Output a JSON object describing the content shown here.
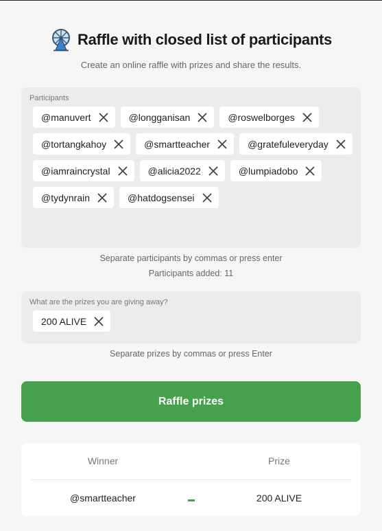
{
  "header": {
    "title": "Raffle with closed list of participants",
    "subtitle": "Create an online raffle with prizes and share the results."
  },
  "participants": {
    "label": "Participants",
    "items": [
      "@manuvert",
      "@longganisan",
      "@roswelborges",
      "@tortangkahoy",
      "@smartteacher",
      "@gratefuleveryday",
      "@iamraincrystal",
      "@alicia2022",
      "@lumpiadobo",
      "@tydynrain",
      "@hatdogsensei"
    ],
    "helper": "Separate participants by commas or press enter",
    "count_text": "Participants added: 11"
  },
  "prizes": {
    "label": "What are the prizes you are giving away?",
    "items": [
      "200 ALIVE"
    ],
    "helper": "Separate prizes by commas or press Enter"
  },
  "action": {
    "raffle_label": "Raffle prizes"
  },
  "results": {
    "winner_header": "Winner",
    "prize_header": "Prize",
    "rows": [
      {
        "winner": "@smartteacher",
        "prize": "200 ALIVE"
      }
    ]
  },
  "colors": {
    "accent": "#45a14b",
    "panel": "#ececec",
    "background": "#f6f6f6"
  },
  "icons": {
    "logo": "ferris-wheel-icon",
    "remove": "close-icon"
  }
}
